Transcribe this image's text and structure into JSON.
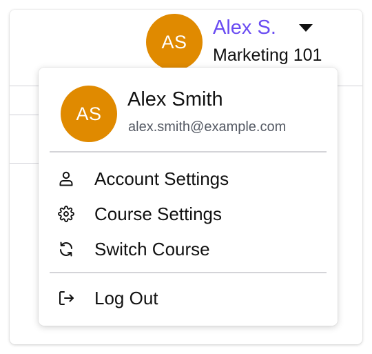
{
  "header": {
    "avatar_initials": "AS",
    "user_name": "Alex S.",
    "course": "Marketing 101",
    "user_name_color": "#6a4cf2",
    "avatar_color": "#e08a00"
  },
  "menu": {
    "avatar_initials": "AS",
    "full_name": "Alex Smith",
    "email": "alex.smith@example.com",
    "items": [
      {
        "label": "Account Settings",
        "icon": "user-icon"
      },
      {
        "label": "Course Settings",
        "icon": "gear-icon"
      },
      {
        "label": "Switch Course",
        "icon": "switch-icon"
      }
    ],
    "logout": {
      "label": "Log Out",
      "icon": "logout-icon"
    }
  }
}
